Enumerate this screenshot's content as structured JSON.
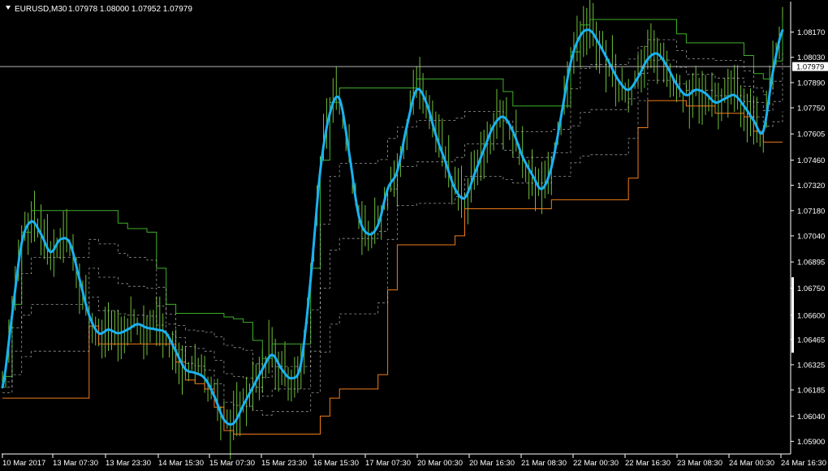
{
  "header": {
    "symbol_label": "EURUSD,M30",
    "ohlc_label": "1.07978 1.08000 1.07952 1.07979"
  },
  "colors": {
    "background": "#000000",
    "price_bars": "#6fbf3a",
    "ma_line": "#1ab2f0",
    "upper_band": "#3fae2a",
    "lower_band": "#f07d1a",
    "dashed_band": "#c9c9c9",
    "axis_text": "#ffffff",
    "current_price_line": "#b4b4b4"
  },
  "chart_data": {
    "type": "line",
    "title": "EURUSD,M30",
    "ylim": [
      1.0583,
      1.0833
    ],
    "y_ticks": [
      "1.08170",
      "1.08030",
      "1.07890",
      "1.07750",
      "1.07605",
      "1.07460",
      "1.07320",
      "1.07180",
      "1.07040",
      "1.06895",
      "1.06750",
      "1.06600",
      "1.06465",
      "1.06325",
      "1.06185",
      "1.06040",
      "1.05900"
    ],
    "x_ticks": [
      "10 Mar 2017",
      "13 Mar 07:30",
      "13 Mar 23:30",
      "14 Mar 15:30",
      "15 Mar 07:30",
      "15 Mar 23:30",
      "16 Mar 15:30",
      "17 Mar 07:30",
      "20 Mar 00:30",
      "20 Mar 16:30",
      "21 Mar 08:30",
      "22 Mar 00:30",
      "22 Mar 16:30",
      "23 Mar 08:30",
      "24 Mar 00:30",
      "24 Mar 16:30"
    ],
    "current_price": 1.07979,
    "current_price_label": "1.07979",
    "series": [
      {
        "values": [
          1.062,
          1.066,
          1.07,
          1.0712,
          1.0705,
          1.0695,
          1.0702,
          1.07,
          1.068,
          1.066,
          1.065,
          1.0652,
          1.065,
          1.0652,
          1.0655,
          1.0653,
          1.0652,
          1.065,
          1.064,
          1.063,
          1.0628,
          1.0625,
          1.0615,
          1.0602,
          1.06,
          1.061,
          1.062,
          1.063,
          1.0638,
          1.063,
          1.0625,
          1.0633,
          1.068,
          1.074,
          1.0772,
          1.078,
          1.075,
          1.0715,
          1.0705,
          1.071,
          1.073,
          1.074,
          1.0765,
          1.0785,
          1.0778,
          1.076,
          1.0745,
          1.073,
          1.0725,
          1.0738,
          1.0752,
          1.0765,
          1.077,
          1.0762,
          1.0748,
          1.0738,
          1.073,
          1.0742,
          1.077,
          1.08,
          1.0815,
          1.0818,
          1.081,
          1.08,
          1.079,
          1.0785,
          1.0792,
          1.0802,
          1.0805,
          1.0798,
          1.0788,
          1.0782,
          1.0785,
          1.0783,
          1.0778,
          1.078,
          1.0782,
          1.0776,
          1.0768,
          1.0762,
          1.0795,
          1.0818
        ]
      }
    ]
  }
}
